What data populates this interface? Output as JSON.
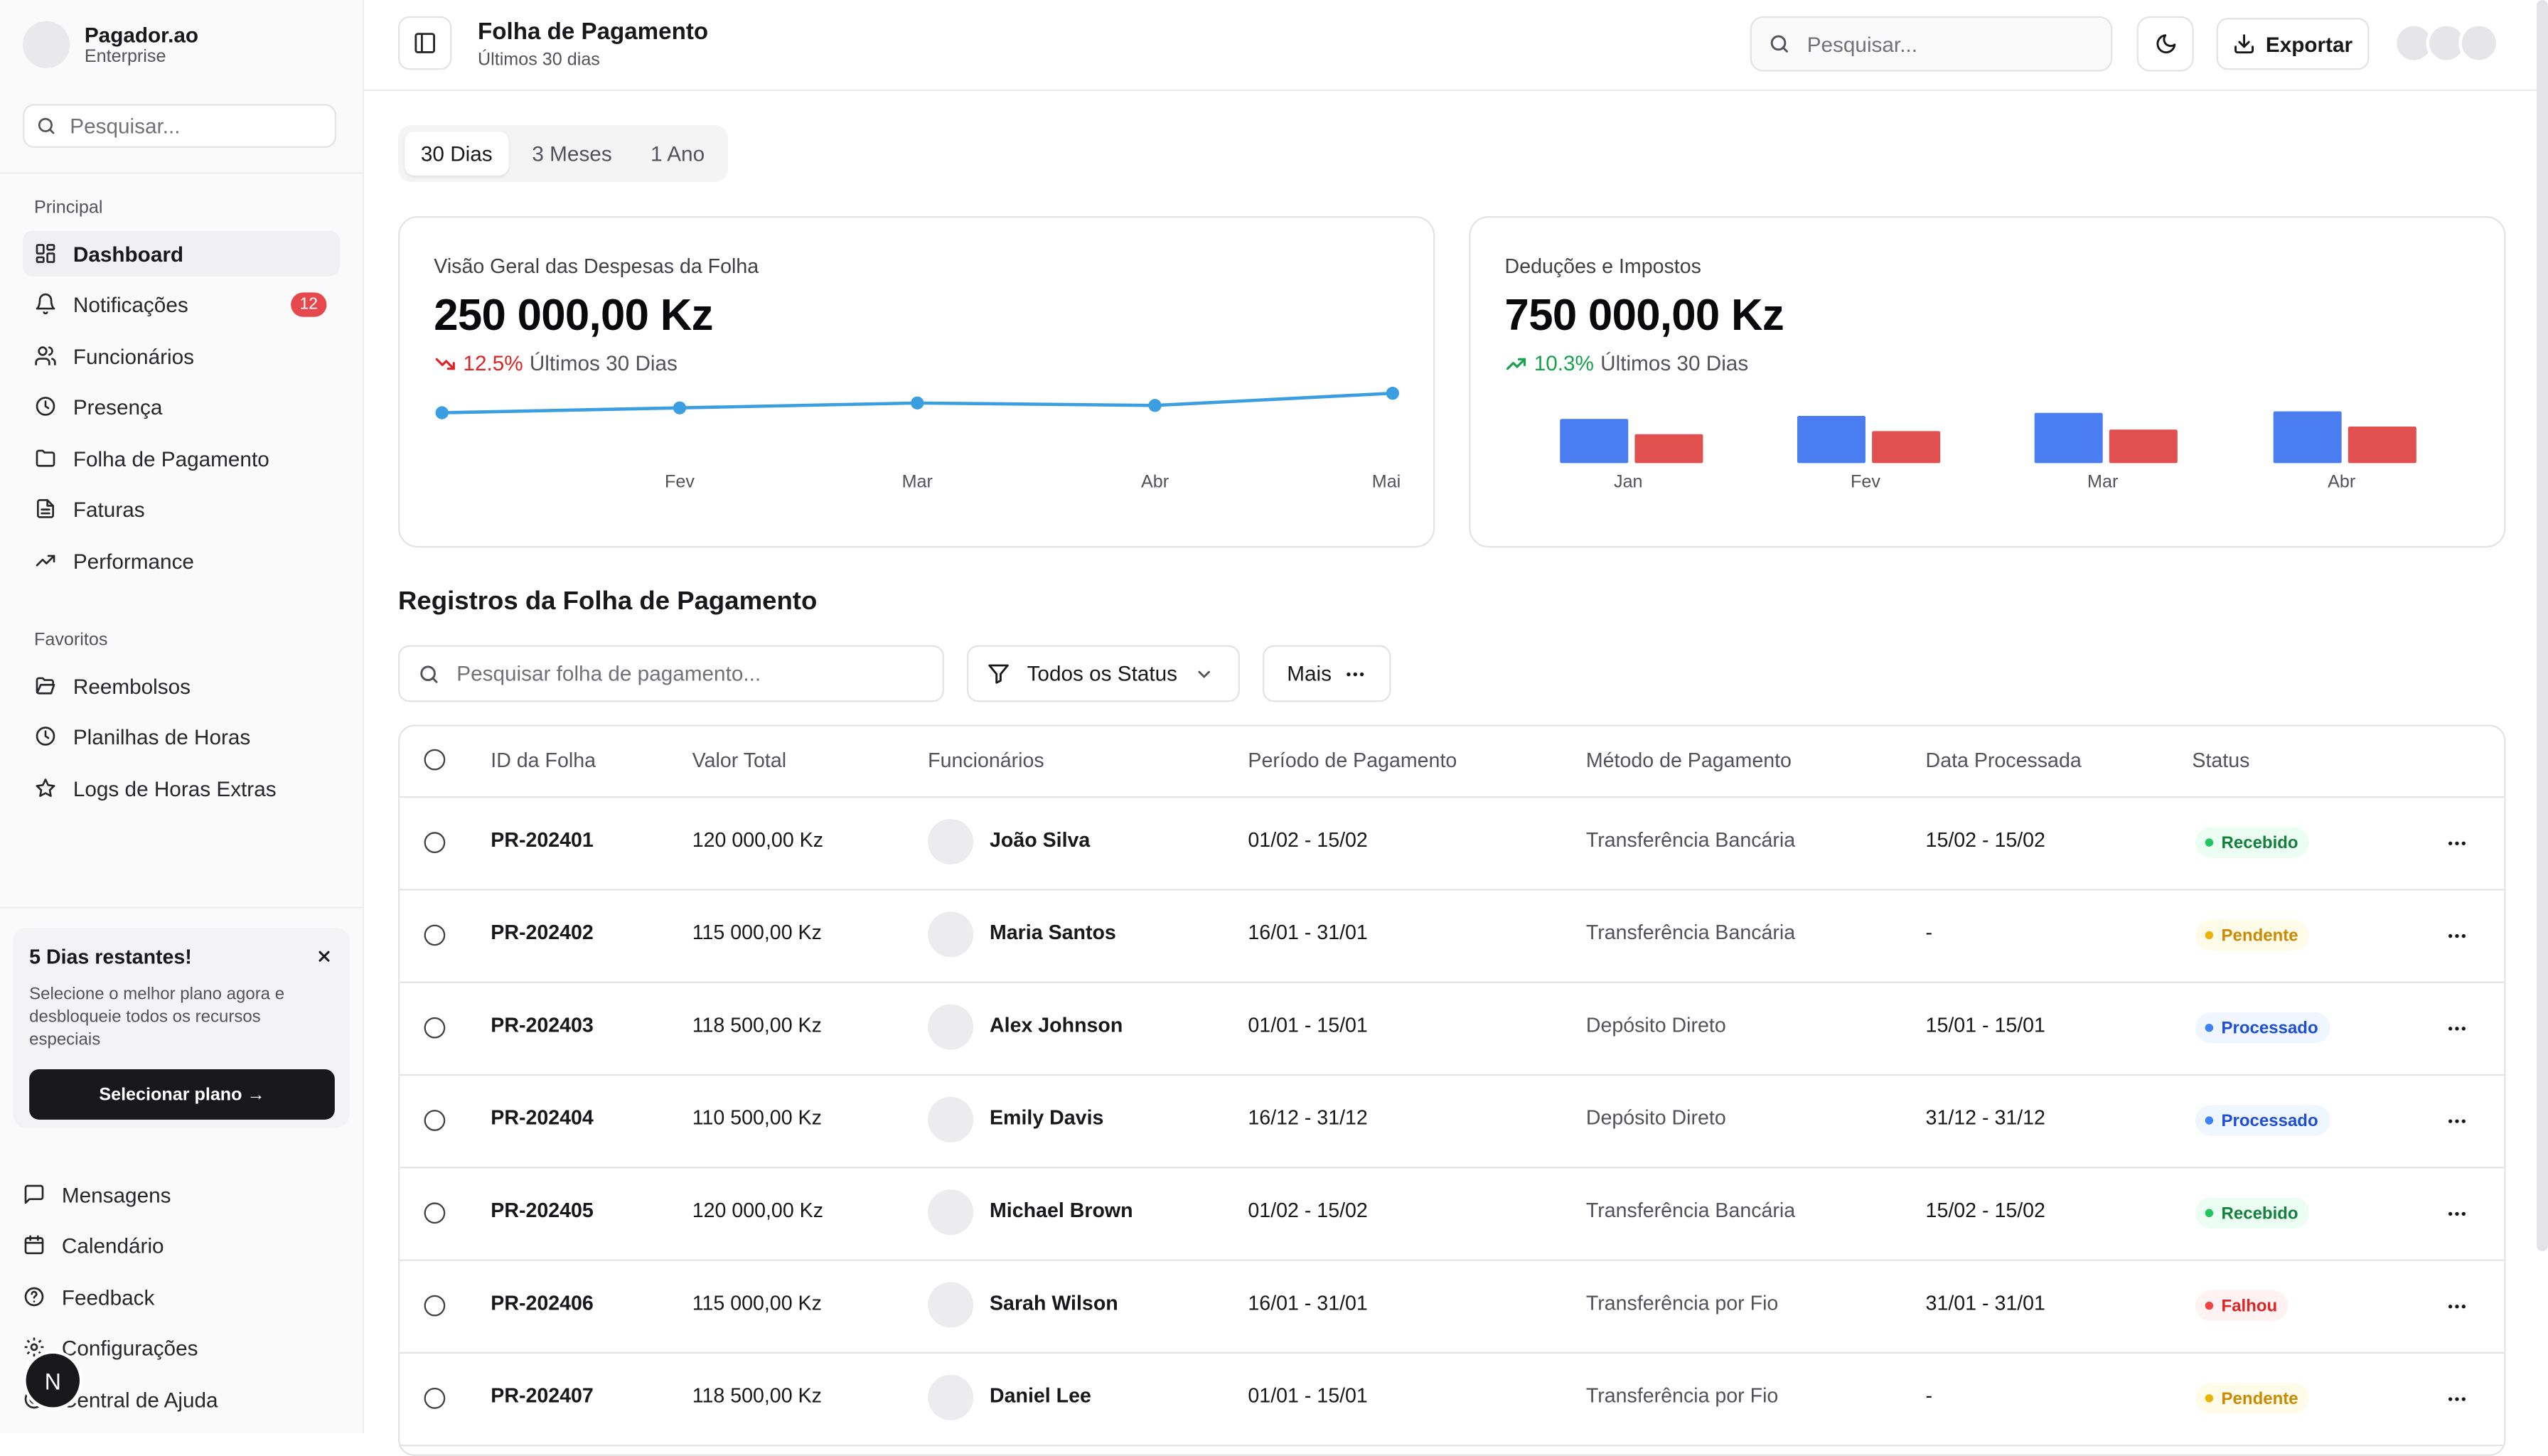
{
  "sidebar": {
    "brand_name": "Pagador.ao",
    "brand_plan": "Enterprise",
    "search_placeholder": "Pesquisar...",
    "section_main": "Principal",
    "main_items": [
      {
        "label": "Dashboard",
        "icon": "grid-icon"
      },
      {
        "label": "Notificações",
        "icon": "bell-icon",
        "badge": "12"
      },
      {
        "label": "Funcionários",
        "icon": "users-icon"
      },
      {
        "label": "Presença",
        "icon": "clock-icon"
      },
      {
        "label": "Folha de Pagamento",
        "icon": "folder-icon"
      },
      {
        "label": "Faturas",
        "icon": "file-text-icon"
      },
      {
        "label": "Performance",
        "icon": "trending-up-icon"
      }
    ],
    "section_favorites": "Favoritos",
    "favorite_items": [
      {
        "label": "Reembolsos",
        "icon": "folder-open-icon"
      },
      {
        "label": "Planilhas de Horas",
        "icon": "clock-icon"
      },
      {
        "label": "Logs de Horas Extras",
        "icon": "star-icon"
      }
    ],
    "promo": {
      "title": "5 Dias restantes!",
      "text": "Selecione o melhor plano agora e desbloqueie todos os recursos especiais",
      "button": "Selecionar plano →"
    },
    "footer_items": [
      {
        "label": "Mensagens",
        "icon": "message-icon"
      },
      {
        "label": "Calendário",
        "icon": "calendar-icon"
      },
      {
        "label": "Feedback",
        "icon": "help-circle-icon"
      },
      {
        "label": "Configurações",
        "icon": "gear-icon"
      },
      {
        "label": "Central de Ajuda",
        "icon": "life-buoy-icon"
      }
    ],
    "user_initial": "N"
  },
  "header": {
    "title": "Folha de Pagamento",
    "subtitle": "Últimos 30 dias",
    "search_placeholder": "Pesquisar...",
    "export_label": "Exportar"
  },
  "periods": [
    "30 Dias",
    "3 Meses",
    "1 Ano"
  ],
  "active_period": "30 Dias",
  "cards": {
    "expenses": {
      "title": "Visão Geral das Despesas da Folha",
      "value": "250 000,00 Kz",
      "trend_pct": "12.5%",
      "trend_label": "Últimos 30 Dias",
      "trend_direction": "down",
      "trend_color": "#dc2626"
    },
    "deductions": {
      "title": "Deduções e Impostos",
      "value": "750 000,00 Kz",
      "trend_pct": "10.3%",
      "trend_label": "Últimos 30 Dias",
      "trend_direction": "up",
      "trend_color": "#16a34a"
    }
  },
  "chart_data": [
    {
      "type": "line",
      "categories": [
        "",
        "Fev",
        "Mar",
        "Abr",
        "Mai"
      ],
      "values": [
        20,
        22,
        24,
        23,
        28
      ],
      "ylim": [
        0,
        100
      ],
      "grid": false,
      "color": "#3b9ee0"
    },
    {
      "type": "bar",
      "categories": [
        "Jan",
        "Fev",
        "Mar",
        "Abr"
      ],
      "series": [
        {
          "values": [
            29,
            31,
            33,
            34
          ],
          "color": "#4a7ef0"
        },
        {
          "values": [
            19,
            21,
            22,
            24
          ],
          "color": "#e0504e"
        }
      ],
      "ylim": [
        0,
        40
      ],
      "grid": false
    }
  ],
  "table": {
    "title": "Registros da Folha de Pagamento",
    "search_placeholder": "Pesquisar folha de pagamento...",
    "status_filter": "Todos os Status",
    "more_label": "Mais",
    "columns": [
      "ID da Folha",
      "Valor Total",
      "Funcionários",
      "Período de Pagamento",
      "Método de Pagamento",
      "Data Processada",
      "Status"
    ],
    "rows": [
      {
        "id": "PR-202401",
        "amount": "120 000,00 Kz",
        "employee": "João Silva",
        "period": "01/02 - 15/02",
        "method": "Transferência Bancária",
        "processed": "15/02 - 15/02",
        "status": "Recebido"
      },
      {
        "id": "PR-202402",
        "amount": "115 000,00 Kz",
        "employee": "Maria Santos",
        "period": "16/01 - 31/01",
        "method": "Transferência Bancária",
        "processed": "-",
        "status": "Pendente"
      },
      {
        "id": "PR-202403",
        "amount": "118 500,00 Kz",
        "employee": "Alex Johnson",
        "period": "01/01 - 15/01",
        "method": "Depósito Direto",
        "processed": "15/01 - 15/01",
        "status": "Processado"
      },
      {
        "id": "PR-202404",
        "amount": "110 500,00 Kz",
        "employee": "Emily Davis",
        "period": "16/12 - 31/12",
        "method": "Depósito Direto",
        "processed": "31/12 - 31/12",
        "status": "Processado"
      },
      {
        "id": "PR-202405",
        "amount": "120 000,00 Kz",
        "employee": "Michael Brown",
        "period": "01/02 - 15/02",
        "method": "Transferência Bancária",
        "processed": "15/02 - 15/02",
        "status": "Recebido"
      },
      {
        "id": "PR-202406",
        "amount": "115 000,00 Kz",
        "employee": "Sarah Wilson",
        "period": "16/01 - 31/01",
        "method": "Transferência por Fio",
        "processed": "31/01 - 31/01",
        "status": "Falhou"
      },
      {
        "id": "PR-202407",
        "amount": "118 500,00 Kz",
        "employee": "Daniel Lee",
        "period": "01/01 - 15/01",
        "method": "Transferência por Fio",
        "processed": "-",
        "status": "Pendente"
      }
    ]
  },
  "status_colors": {
    "Recebido": {
      "bg": "#ecfdf3",
      "fg": "#15803d",
      "dot": "#22c55e"
    },
    "Pendente": {
      "bg": "#fefce8",
      "fg": "#ca8a04",
      "dot": "#eab308"
    },
    "Processado": {
      "bg": "#eff6ff",
      "fg": "#1d4ed8",
      "dot": "#3b82f6"
    },
    "Falhou": {
      "bg": "#fef2f2",
      "fg": "#dc2626",
      "dot": "#ef4444"
    }
  }
}
